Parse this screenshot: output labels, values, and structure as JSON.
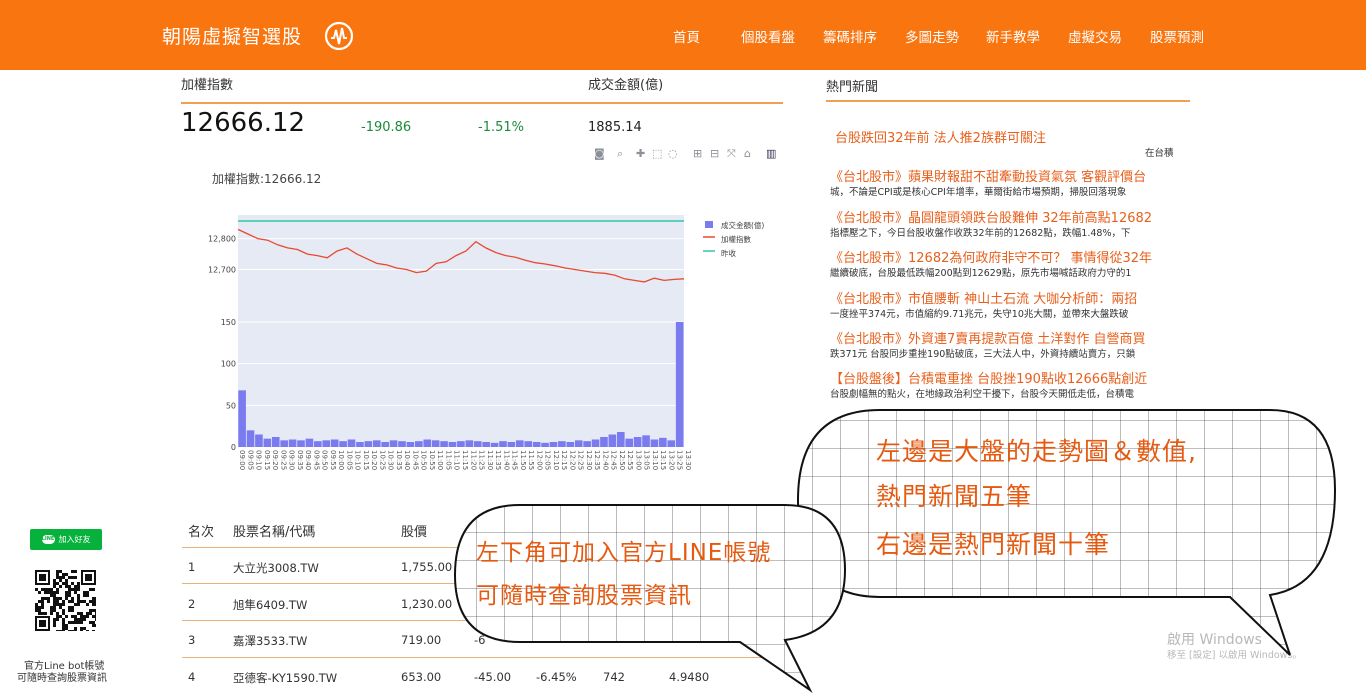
{
  "nav": {
    "brand": "朝陽虛擬智選股",
    "items": [
      "首頁",
      "個股看盤",
      "籌碼排序",
      "多圖走勢",
      "新手教學",
      "虛擬交易",
      "股票預測"
    ]
  },
  "index": {
    "label": "加權指數",
    "volume_label": "成交金額(億)",
    "value": "12666.12",
    "change": "-190.86",
    "change_pct": "-1.51%",
    "volume": "1885.14",
    "chart_title": "加權指數:12666.12"
  },
  "chart_data": {
    "type": "line",
    "title": "加權指數:12666.12",
    "legend": [
      "成交金額(億)",
      "加權指數",
      "昨收"
    ],
    "legend_position": "top-right",
    "y_ticks_top": [
      "12,800",
      "12,700"
    ],
    "y_ticks_bottom": [
      "150",
      "100",
      "50",
      "0"
    ],
    "x_ticks": [
      "09:00",
      "09:05",
      "09:10",
      "09:15",
      "09:20",
      "09:25",
      "09:30",
      "09:35",
      "09:40",
      "09:45",
      "09:50",
      "09:55",
      "10:00",
      "10:05",
      "10:10",
      "10:15",
      "10:20",
      "10:25",
      "10:30",
      "10:35",
      "10:40",
      "10:45",
      "10:50",
      "10:55",
      "11:00",
      "11:05",
      "11:10",
      "11:15",
      "11:20",
      "11:25",
      "11:30",
      "11:35",
      "11:40",
      "11:45",
      "11:50",
      "11:55",
      "12:00",
      "12:05",
      "12:10",
      "12:15",
      "12:20",
      "12:25",
      "12:30",
      "12:35",
      "12:40",
      "12:45",
      "12:50",
      "12:55",
      "13:00",
      "13:05",
      "13:10",
      "13:15",
      "13:20",
      "13:25",
      "13:30"
    ],
    "series": [
      {
        "name": "加權指數",
        "color": "#e8492f",
        "values": [
          12830,
          12815,
          12800,
          12795,
          12780,
          12770,
          12765,
          12750,
          12745,
          12738,
          12760,
          12770,
          12750,
          12735,
          12720,
          12715,
          12705,
          12700,
          12690,
          12695,
          12720,
          12725,
          12745,
          12760,
          12790,
          12770,
          12755,
          12745,
          12740,
          12730,
          12722,
          12718,
          12712,
          12705,
          12700,
          12695,
          12690,
          12688,
          12682,
          12670,
          12665,
          12660,
          12672,
          12665,
          12668,
          12670
        ]
      },
      {
        "name": "昨收",
        "color": "#2ec7a5",
        "value": 12857
      }
    ],
    "volume": {
      "name": "成交金額(億)",
      "color": "#7b7bf0",
      "values": [
        68,
        20,
        15,
        10,
        12,
        8,
        9,
        8,
        10,
        7,
        8,
        9,
        7,
        9,
        6,
        7,
        8,
        6,
        8,
        7,
        6,
        7,
        9,
        8,
        7,
        6,
        7,
        8,
        7,
        6,
        5,
        7,
        6,
        8,
        7,
        6,
        5,
        6,
        7,
        6,
        8,
        7,
        9,
        12,
        15,
        18,
        10,
        12,
        14,
        9,
        11,
        8,
        150
      ]
    }
  },
  "news": {
    "header": "熱門新聞",
    "items": [
      {
        "title": "台股跌回32年前 法人推2族群可關注",
        "sub": "在台積"
      },
      {
        "title": "《台北股市》蘋果財報甜不甜牽動投資氣氛 客觀評價台",
        "sub": "城，不論是CPI或是核心CPI年增率，華爾街給市場預期，掃股回落現象"
      },
      {
        "title": "《台北股市》晶圓龍頭領跌台股難伸 32年前高點12682",
        "sub": "指標壓之下，今日台股收盤作收跌32年前的12682點，跌幅1.48%，下"
      },
      {
        "title": "《台北股市》12682為何政府非守不可？ 事情得從32年",
        "sub": "繼續破底，台股最低跌幅200點到12629點，原先市場喊話政府力守的1"
      },
      {
        "title": "《台北股市》市值腰斬 神山土石流 大咖分析師：兩招",
        "sub": "一度挫平374元，市值縮約9.71兆元，失守10兆大關，並帶來大盤跌破"
      },
      {
        "title": "《台北股市》外資連7賣再提款百億 土洋對作 自營商買",
        "sub": "跌371元 台股同步重挫190點破底，三大法人中，外資持續站賣方，只鎖"
      },
      {
        "title": "【台股盤後】台積電重挫 台股挫190點收12666點創近",
        "sub": "台股劇幅無的點火，在地緣政治利空干擾下，台股今天開低走低，台積電"
      }
    ]
  },
  "table": {
    "headers": [
      "名次",
      "股票名稱/代碼",
      "股價"
    ],
    "rows": [
      {
        "rank": "1",
        "name": "大立光3008.TW",
        "price": "1,755.00",
        "chg": "",
        "pct": "",
        "vol": "",
        "amt": ""
      },
      {
        "rank": "2",
        "name": "旭隼6409.TW",
        "price": "1,230.00",
        "chg": "",
        "pct": "",
        "vol": "",
        "amt": ""
      },
      {
        "rank": "3",
        "name": "嘉澤3533.TW",
        "price": "719.00",
        "chg": "-6",
        "pct": "",
        "vol": "",
        "amt": ""
      },
      {
        "rank": "4",
        "name": "亞德客-KY1590.TW",
        "price": "653.00",
        "chg": "-45.00",
        "pct": "-6.45%",
        "vol": "742",
        "amt": "4.9480"
      }
    ]
  },
  "line": {
    "button": "加入好友",
    "caption1": "官方Line bot帳號",
    "caption2": "可隨時查詢股票資訊"
  },
  "bubbles": {
    "left": [
      "左下角可加入官方LINE帳號",
      "可隨時查詢股票資訊"
    ],
    "right": [
      "左邊是大盤的走勢圖＆數值,",
      "熱門新聞五筆",
      "右邊是熱門新聞十筆"
    ]
  },
  "watermark": {
    "line1": "啟用 Windows",
    "line2": "移至 [設定] 以啟用 Windows。"
  }
}
